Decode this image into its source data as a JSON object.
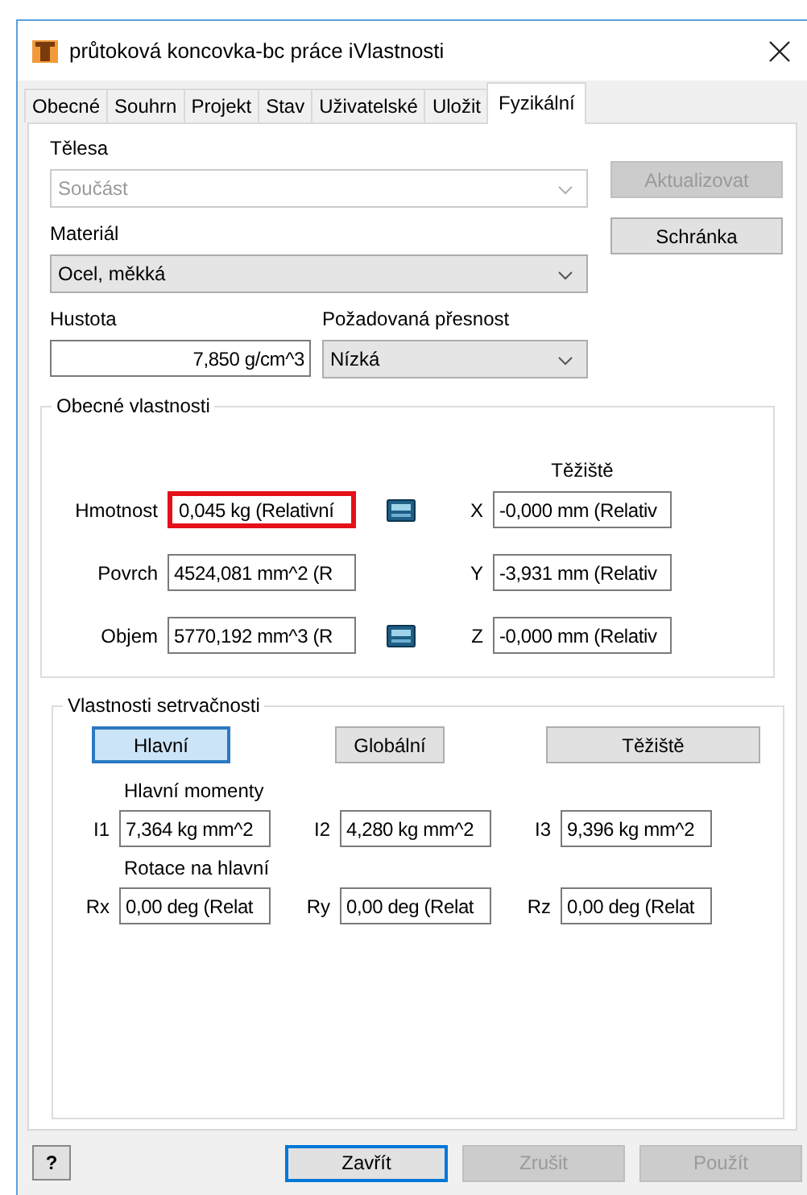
{
  "window": {
    "title": "průtoková koncovka-bc práce iVlastnosti"
  },
  "tabs": [
    {
      "label": "Obecné",
      "selected": false
    },
    {
      "label": "Souhrn",
      "selected": false
    },
    {
      "label": "Projekt",
      "selected": false
    },
    {
      "label": "Stav",
      "selected": false
    },
    {
      "label": "Uživatelské",
      "selected": false
    },
    {
      "label": "Uložit",
      "selected": false
    },
    {
      "label": "Fyzikální",
      "selected": true
    }
  ],
  "bodies": {
    "label": "Tělesa",
    "value": "Součást",
    "disabled": true
  },
  "update_button": {
    "label": "Aktualizovat",
    "disabled": true
  },
  "material": {
    "label": "Materiál",
    "value": "Ocel, měkká",
    "disabled": false
  },
  "clipboard_button": {
    "label": "Schránka",
    "disabled": false
  },
  "density": {
    "label": "Hustota",
    "value": "7,850 g/cm^3"
  },
  "accuracy": {
    "label": "Požadovaná přesnost",
    "value": "Nízká",
    "disabled": false
  },
  "general": {
    "title": "Obecné vlastnosti",
    "center_heading": "Těžiště",
    "rows": [
      {
        "label": "Hmotnost",
        "value": "0,045 kg (Relativní",
        "highlighted": true,
        "calculator": true,
        "axis": "X",
        "center": "-0,000 mm (Relativ"
      },
      {
        "label": "Povrch",
        "value": "4524,081 mm^2 (R",
        "highlighted": false,
        "calculator": false,
        "axis": "Y",
        "center": "-3,931 mm (Relativ"
      },
      {
        "label": "Objem",
        "value": "5770,192 mm^3 (R",
        "highlighted": false,
        "calculator": true,
        "axis": "Z",
        "center": "-0,000 mm (Relativ"
      }
    ]
  },
  "inertia": {
    "title": "Vlastnosti setrvačnosti",
    "views": [
      {
        "label": "Hlavní",
        "selected": true
      },
      {
        "label": "Globální",
        "selected": false
      },
      {
        "label": "Těžiště",
        "selected": false
      }
    ],
    "moments_heading": "Hlavní momenty",
    "moments": [
      {
        "label": "I1",
        "value": "7,364 kg mm^2"
      },
      {
        "label": "I2",
        "value": "4,280 kg mm^2"
      },
      {
        "label": "I3",
        "value": "9,396 kg mm^2"
      }
    ],
    "rotation_heading": "Rotace na hlavní",
    "rotations": [
      {
        "label": "Rx",
        "value": "0,00 deg (Relat"
      },
      {
        "label": "Ry",
        "value": "0,00 deg (Relat"
      },
      {
        "label": "Rz",
        "value": "0,00 deg (Relat"
      }
    ]
  },
  "help_button": {
    "label": "?"
  },
  "footer": {
    "buttons": [
      {
        "label": "Zavřít",
        "default": true,
        "disabled": false
      },
      {
        "label": "Zrušit",
        "default": false,
        "disabled": true
      },
      {
        "label": "Použít",
        "default": false,
        "disabled": true
      }
    ]
  }
}
